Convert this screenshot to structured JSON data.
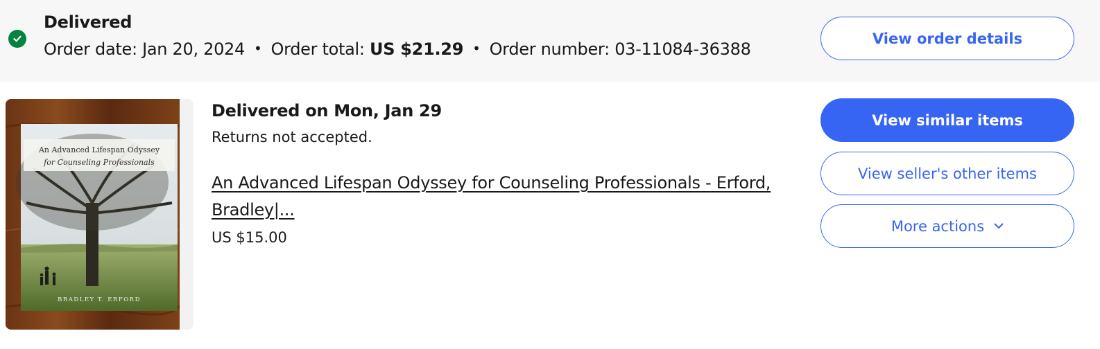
{
  "order": {
    "status": "Delivered",
    "date_label": "Order date:",
    "date_value": "Jan 20, 2024",
    "total_label": "Order total:",
    "total_value": "US $21.29",
    "number_label": "Order number:",
    "number_value": "03-11084-36388",
    "separator": "•",
    "view_details_label": "View order details"
  },
  "item": {
    "delivery_status": "Delivered on Mon, Jan 29",
    "returns": "Returns not accepted.",
    "title": "An Advanced Lifespan Odyssey for Counseling Professionals - Erford, Bradley|...",
    "price": "US $15.00",
    "image": {
      "cover_title_line1": "An Advanced Lifespan Odyssey",
      "cover_title_line2": "for Counseling Professionals",
      "cover_author": "BRADLEY T. ERFORD"
    }
  },
  "actions": {
    "similar_label": "View similar items",
    "seller_label": "View seller's other items",
    "more_label": "More actions"
  },
  "icons": {
    "status": "check-circle-icon",
    "more": "chevron-down-icon"
  },
  "colors": {
    "accent": "#3665f3",
    "success": "#05823f",
    "header_bg": "#f7f7f7",
    "text": "#191919"
  }
}
